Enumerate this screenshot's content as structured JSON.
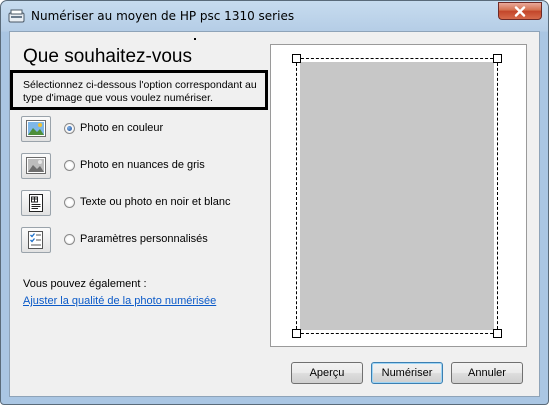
{
  "window": {
    "title": "Numériser au moyen de HP psc 1310 series"
  },
  "heading": "Que souhaitez-vous",
  "instruction": {
    "line1": "Sélectionnez ci-dessous l'option correspondant au",
    "line2": "type d'image que vous voulez numériser."
  },
  "options": [
    {
      "label": "Photo en couleur",
      "icon": "color-photo-icon",
      "selected": true
    },
    {
      "label": "Photo en nuances de gris",
      "icon": "grayscale-photo-icon",
      "selected": false
    },
    {
      "label": "Texte ou photo en noir et blanc",
      "icon": "black-white-text-icon",
      "selected": false
    },
    {
      "label": "Paramètres personnalisés",
      "icon": "custom-settings-icon",
      "selected": false
    }
  ],
  "also_label": "Vous pouvez également :",
  "link_text": "Ajuster la qualité de la photo numérisée",
  "buttons": {
    "preview": "Aperçu",
    "scan": "Numériser",
    "cancel": "Annuler"
  },
  "colors": {
    "link": "#0b5ac8",
    "scan_area": "#c7c7c7",
    "close_button": "#c3452a"
  }
}
